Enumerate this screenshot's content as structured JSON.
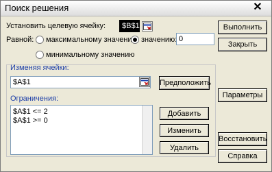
{
  "title": "Поиск решения",
  "target": {
    "label": "Установить целевую ячейку:",
    "value": "$B$1"
  },
  "equal": {
    "label": "Равной:",
    "options": [
      "максимальному значению",
      "значению:",
      "минимальному значению"
    ],
    "selected_index": 1,
    "value": "0"
  },
  "changing": {
    "label": "Изменяя ячейки:",
    "value": "$A$1",
    "guess_button": "Предположить"
  },
  "constraints": {
    "label": "Ограничения:",
    "items": [
      "$A$1 <= 2",
      "$A$1 >= 0"
    ]
  },
  "buttons": {
    "execute": "Выполнить",
    "close": "Закрыть",
    "parameters": "Параметры",
    "add": "Добавить",
    "change": "Изменить",
    "delete": "Удалить",
    "restore": "Восстановить",
    "help": "Справка"
  },
  "icons": {
    "close": "close-icon",
    "collapse_dialog": "range-select-icon"
  }
}
